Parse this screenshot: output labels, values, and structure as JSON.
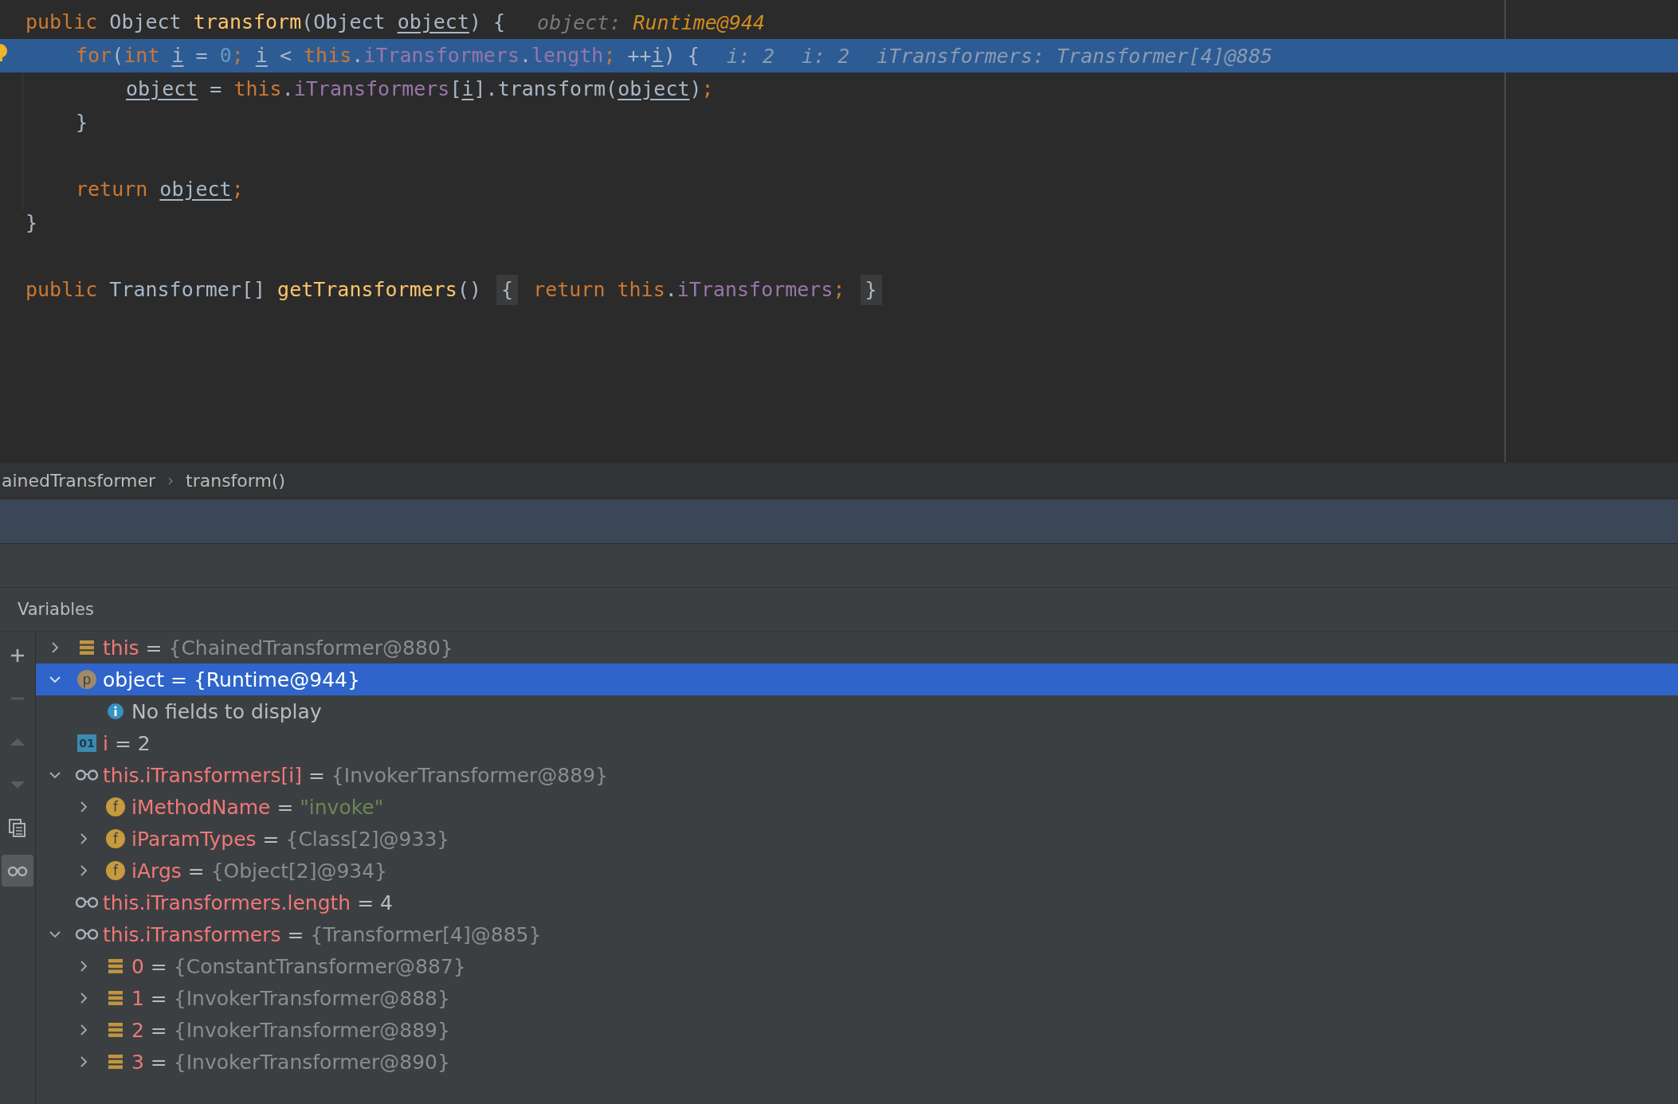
{
  "editor": {
    "lines": [
      {
        "current": false,
        "kind": "top",
        "tokens": [
          {
            "kind": "kw",
            "text": "public"
          },
          {
            "kind": "plain",
            "text": " Object "
          },
          {
            "kind": "fn",
            "text": "transform"
          },
          {
            "kind": "plain",
            "text": "(Object "
          },
          {
            "kind": "var",
            "text": "object"
          },
          {
            "kind": "plain",
            "text": ") {"
          }
        ],
        "hints": [
          {
            "label": "object:",
            "value": "Runtime@944"
          }
        ]
      },
      {
        "current": true,
        "kind": "body",
        "tokens": [
          {
            "kind": "kw",
            "text": "for"
          },
          {
            "kind": "plain",
            "text": "("
          },
          {
            "kind": "kw",
            "text": "int "
          },
          {
            "kind": "var",
            "text": "i"
          },
          {
            "kind": "plain",
            "text": " = "
          },
          {
            "kind": "num",
            "text": "0"
          },
          {
            "kind": "kw",
            "text": "; "
          },
          {
            "kind": "var",
            "text": "i"
          },
          {
            "kind": "plain",
            "text": " < "
          },
          {
            "kind": "kw",
            "text": "this"
          },
          {
            "kind": "plain",
            "text": "."
          },
          {
            "kind": "field",
            "text": "iTransformers"
          },
          {
            "kind": "plain",
            "text": "."
          },
          {
            "kind": "field",
            "text": "length"
          },
          {
            "kind": "kw",
            "text": "; "
          },
          {
            "kind": "plain",
            "text": "++"
          },
          {
            "kind": "var",
            "text": "i"
          },
          {
            "kind": "plain",
            "text": ") {"
          }
        ],
        "hints": [
          {
            "label": "i:",
            "value": "2"
          },
          {
            "label": "i:",
            "value": "2"
          },
          {
            "label": "iTransformers:",
            "value": "Transformer[4]@885"
          }
        ]
      },
      {
        "current": false,
        "kind": "inner",
        "tokens": [
          {
            "kind": "var",
            "text": "object"
          },
          {
            "kind": "plain",
            "text": " = "
          },
          {
            "kind": "kw",
            "text": "this"
          },
          {
            "kind": "plain",
            "text": "."
          },
          {
            "kind": "field",
            "text": "iTransformers"
          },
          {
            "kind": "plain",
            "text": "["
          },
          {
            "kind": "var",
            "text": "i"
          },
          {
            "kind": "plain",
            "text": "].transform("
          },
          {
            "kind": "var",
            "text": "object"
          },
          {
            "kind": "plain",
            "text": ")"
          },
          {
            "kind": "kw",
            "text": ";"
          }
        ]
      },
      {
        "current": false,
        "kind": "body",
        "tokens": [
          {
            "kind": "plain",
            "text": "}"
          }
        ]
      },
      {
        "current": false,
        "kind": "top"
      },
      {
        "current": false,
        "kind": "body",
        "tokens": [
          {
            "kind": "kw",
            "text": "return "
          },
          {
            "kind": "var",
            "text": "object"
          },
          {
            "kind": "kw",
            "text": ";"
          }
        ]
      },
      {
        "current": false,
        "kind": "top",
        "tokens": [
          {
            "kind": "plain",
            "text": "}"
          }
        ]
      },
      {
        "current": false,
        "kind": "top"
      },
      {
        "current": false,
        "kind": "top",
        "tokens": [
          {
            "kind": "kw",
            "text": "public"
          },
          {
            "kind": "plain",
            "text": " Transformer[] "
          },
          {
            "kind": "fn",
            "text": "getTransformers"
          },
          {
            "kind": "plain",
            "text": "() "
          },
          {
            "kind": "fold",
            "text": "{"
          },
          {
            "kind": "kw",
            "text": " return this"
          },
          {
            "kind": "plain",
            "text": "."
          },
          {
            "kind": "field",
            "text": "iTransformers"
          },
          {
            "kind": "kw",
            "text": "; "
          },
          {
            "kind": "fold",
            "text": "}"
          }
        ]
      }
    ]
  },
  "breadcrumb": [
    "ainedTransformer",
    "transform()"
  ],
  "variables": {
    "title": "Variables",
    "toolbar": [
      {
        "kind": "add",
        "disabled": false,
        "selected": false
      },
      {
        "kind": "remove",
        "disabled": true,
        "selected": false
      },
      {
        "kind": "up",
        "disabled": true,
        "selected": false
      },
      {
        "kind": "down",
        "disabled": true,
        "selected": false
      },
      {
        "kind": "copy",
        "disabled": false,
        "selected": false
      },
      {
        "kind": "watches",
        "disabled": false,
        "selected": true
      }
    ],
    "nodes": [
      {
        "kind": "fields",
        "name": "this",
        "operator": "=",
        "value": "{ChainedTransformer@880}",
        "color": "#8c8c8c",
        "expanded": false,
        "selected": false
      },
      {
        "kind": "param",
        "glyph": "p",
        "name": "object",
        "operator": "=",
        "value": "{Runtime@944}",
        "expanded": true,
        "selected": true,
        "children": [
          {
            "kind": "info",
            "text": "No fields to display",
            "selected": false
          }
        ]
      },
      {
        "kind": "primitive",
        "glyph": "01",
        "name": "i",
        "operator": "=",
        "value": "2",
        "color": "#bbbbbb",
        "selected": false
      },
      {
        "kind": "watch",
        "name": "this.iTransformers[i]",
        "operator": "=",
        "value": "{InvokerTransformer@889}",
        "color": "#8c8c8c",
        "expanded": true,
        "selected": false,
        "children": [
          {
            "kind": "field",
            "glyph": "f",
            "name": "iMethodName",
            "operator": "=",
            "value": "\"invoke\"",
            "color": "#6a8759",
            "expanded": false,
            "selected": false
          },
          {
            "kind": "field",
            "glyph": "f",
            "name": "iParamTypes",
            "operator": "=",
            "value": "{Class[2]@933}",
            "color": "#8c8c8c",
            "expanded": false,
            "selected": false
          },
          {
            "kind": "field",
            "glyph": "f",
            "name": "iArgs",
            "operator": "=",
            "value": "{Object[2]@934}",
            "color": "#8c8c8c",
            "expanded": false,
            "selected": false
          }
        ]
      },
      {
        "kind": "watch",
        "name": "this.iTransformers.length",
        "operator": "=",
        "value": "4",
        "color": "#bbbbbb",
        "selected": false
      },
      {
        "kind": "watch",
        "name": "this.iTransformers",
        "operator": "=",
        "value": "{Transformer[4]@885}",
        "color": "#8c8c8c",
        "expanded": true,
        "selected": false,
        "children": [
          {
            "kind": "fields",
            "name": "0",
            "operator": "=",
            "value": "{ConstantTransformer@887}",
            "color": "#8c8c8c",
            "expanded": false,
            "selected": false
          },
          {
            "kind": "fields",
            "name": "1",
            "operator": "=",
            "value": "{InvokerTransformer@888}",
            "color": "#8c8c8c",
            "expanded": false,
            "selected": false
          },
          {
            "kind": "fields",
            "name": "2",
            "operator": "=",
            "value": "{InvokerTransformer@889}",
            "color": "#8c8c8c",
            "expanded": false,
            "selected": false
          },
          {
            "kind": "fields",
            "name": "3",
            "operator": "=",
            "value": "{InvokerTransformer@890}",
            "color": "#8c8c8c",
            "expanded": false,
            "selected": false
          }
        ]
      }
    ]
  }
}
